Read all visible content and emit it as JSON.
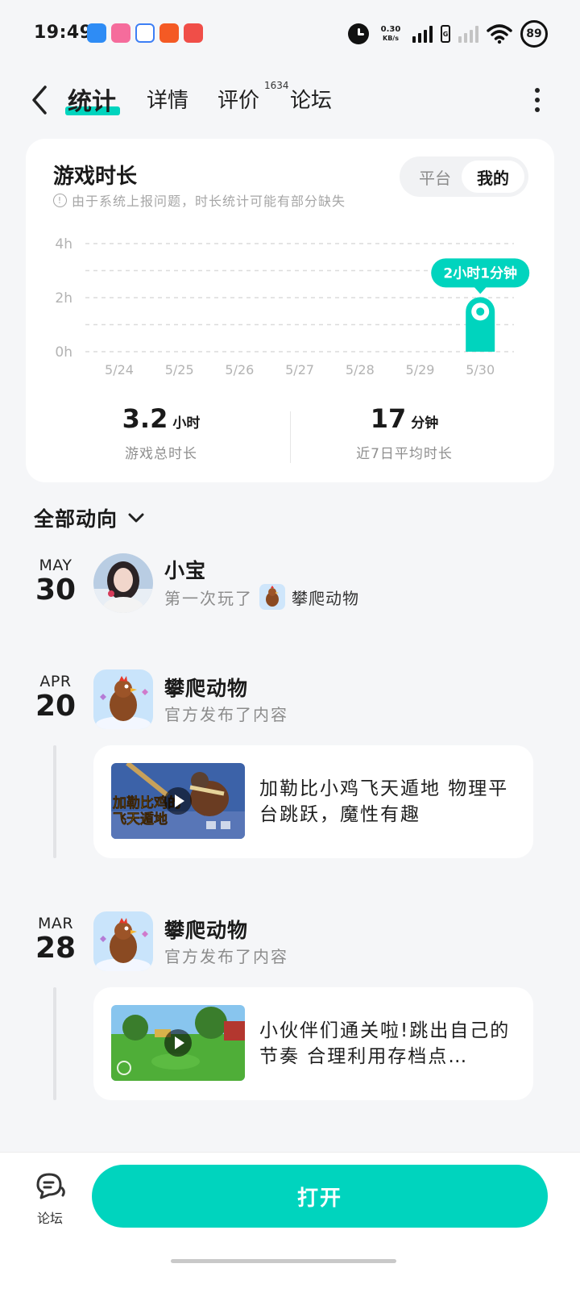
{
  "status_bar": {
    "time": "19:49",
    "net_speed": "0.30",
    "net_unit": "KB/s",
    "battery": "89",
    "network_badge": "4G"
  },
  "tabs": [
    {
      "label": "统计",
      "active": true
    },
    {
      "label": "详情",
      "active": false
    },
    {
      "label": "评价",
      "active": false,
      "badge": "1634"
    },
    {
      "label": "论坛",
      "active": false
    }
  ],
  "stats_card": {
    "title": "游戏时长",
    "notice": "由于系统上报问题，时长统计可能有部分缺失",
    "toggle": {
      "options": [
        "平台",
        "我的"
      ],
      "selected": "我的"
    },
    "tooltip": "2小时1分钟",
    "total": {
      "value": "3.2",
      "unit": "小时",
      "label": "游戏总时长"
    },
    "average": {
      "value": "17",
      "unit": "分钟",
      "label": "近7日平均时长"
    }
  },
  "chart_data": {
    "type": "bar",
    "categories": [
      "5/24",
      "5/25",
      "5/26",
      "5/27",
      "5/28",
      "5/29",
      "5/30"
    ],
    "values": [
      0,
      0,
      0,
      0,
      0,
      0,
      2.02
    ],
    "y_ticks": [
      "4h",
      "2h",
      "0h"
    ],
    "ylim": [
      0,
      4
    ],
    "unit": "h",
    "grid": true,
    "highlight_color": "#00d4be"
  },
  "activity": {
    "header": "全部动向",
    "items": [
      {
        "month": "MAY",
        "day": "30",
        "name": "小宝",
        "sub_prefix": "第一次玩了",
        "game_name": "攀爬动物",
        "kind": "user"
      },
      {
        "month": "APR",
        "day": "20",
        "name": "攀爬动物",
        "sub": "官方发布了内容",
        "kind": "official",
        "post": {
          "text": "加勒比小鸡飞天遁地 物理平台跳跃，魔性有趣",
          "thumb_text": "加勒比鸡的飞天遁地"
        }
      },
      {
        "month": "MAR",
        "day": "28",
        "name": "攀爬动物",
        "sub": "官方发布了内容",
        "kind": "official",
        "post": {
          "text": "小伙伴们通关啦!跳出自己的节奏 合理利用存档点…"
        }
      }
    ]
  },
  "bottom_bar": {
    "forum_label": "论坛",
    "open_label": "打开"
  },
  "colors": {
    "accent": "#00d4be",
    "background": "#f5f6f8"
  }
}
